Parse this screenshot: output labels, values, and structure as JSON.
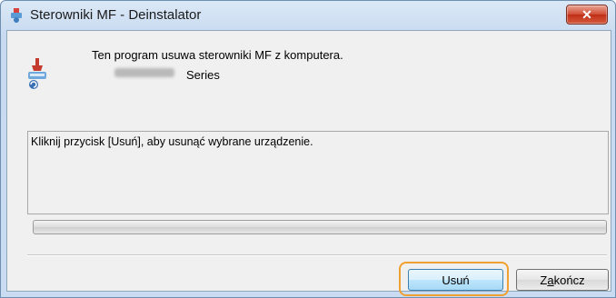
{
  "window": {
    "title": "Sterowniki MF - Deinstalator",
    "close_label": "✕"
  },
  "main": {
    "description": "Ten program usuwa sterowniki MF z komputera.",
    "series_label": "Series",
    "message": "Kliknij przycisk [Usuń], aby usunąć wybrane urządzenie.",
    "progress_percent": 0
  },
  "buttons": {
    "remove_label": "Usuń",
    "finish_pre": "Z",
    "finish_accel": "a",
    "finish_post": "kończ"
  },
  "colors": {
    "highlight": "#f0a030",
    "close_button": "#cf4b33"
  }
}
